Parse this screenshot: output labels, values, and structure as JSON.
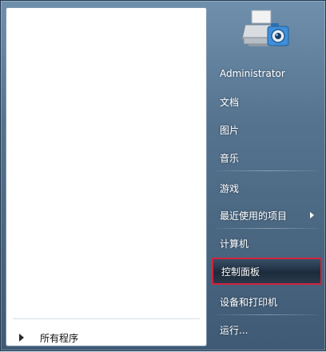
{
  "right_menu": {
    "items": [
      {
        "label": "Administrator"
      },
      {
        "label": "文档"
      },
      {
        "label": "图片"
      },
      {
        "label": "音乐"
      },
      {
        "label": "游戏"
      },
      {
        "label": "最近使用的项目"
      },
      {
        "label": "计算机"
      },
      {
        "label": "控制面板"
      },
      {
        "label": "设备和打印机"
      },
      {
        "label": "运行..."
      }
    ],
    "highlight_color": "#d2233c"
  },
  "left_panel": {
    "all_programs_label": "所有程序"
  },
  "icons": {
    "user_picture": "printer-camera-icon",
    "submenu_arrow": "chevron-right-icon",
    "all_programs_arrow": "triangle-right-icon"
  }
}
